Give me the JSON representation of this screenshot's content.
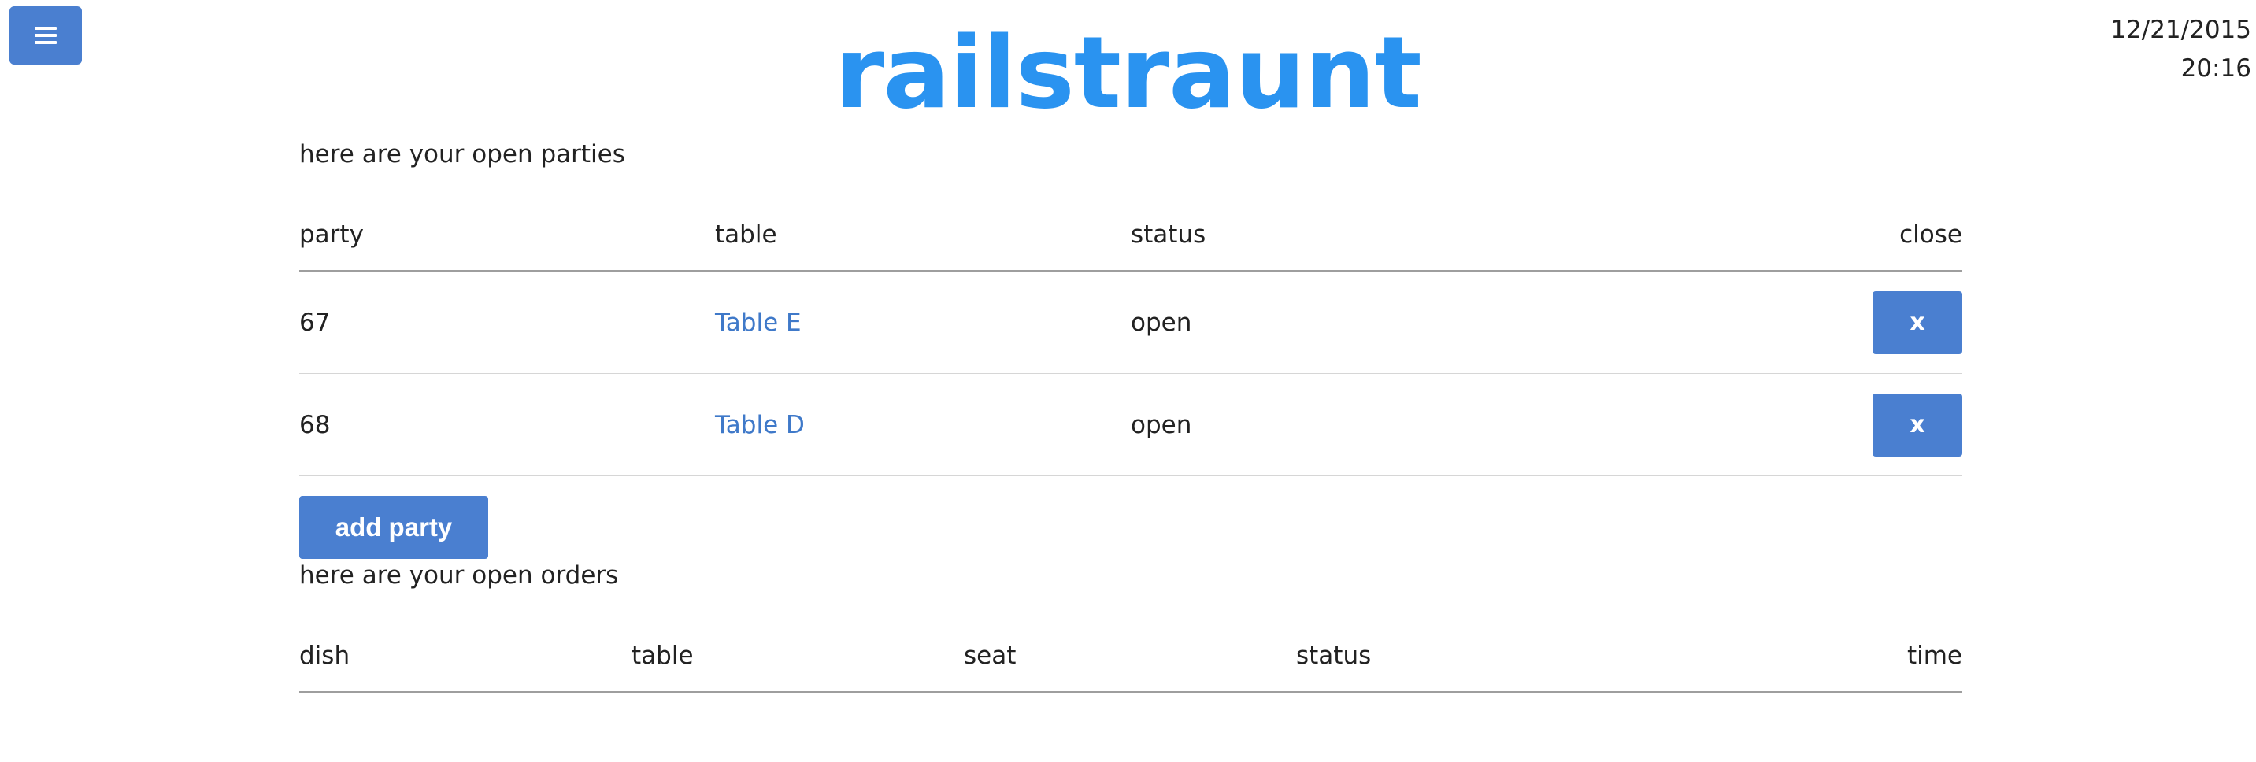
{
  "header": {
    "app_title": "railstraunt",
    "menu_icon": "hamburger-menu-icon",
    "date": "12/21/2015",
    "time": "20:16"
  },
  "parties": {
    "heading": "here are your open parties",
    "columns": [
      "party",
      "table",
      "status",
      "close"
    ],
    "rows": [
      {
        "party": "67",
        "table": "Table E",
        "status": "open",
        "close": "x"
      },
      {
        "party": "68",
        "table": "Table D",
        "status": "open",
        "close": "x"
      }
    ],
    "add_label": "add party"
  },
  "orders": {
    "heading": "here are your open orders",
    "columns": [
      "dish",
      "table",
      "seat",
      "status",
      "time"
    ],
    "rows": []
  },
  "colors": {
    "brand": "#2a93f0",
    "button": "#4a7fd0",
    "link": "#3f79c9"
  }
}
